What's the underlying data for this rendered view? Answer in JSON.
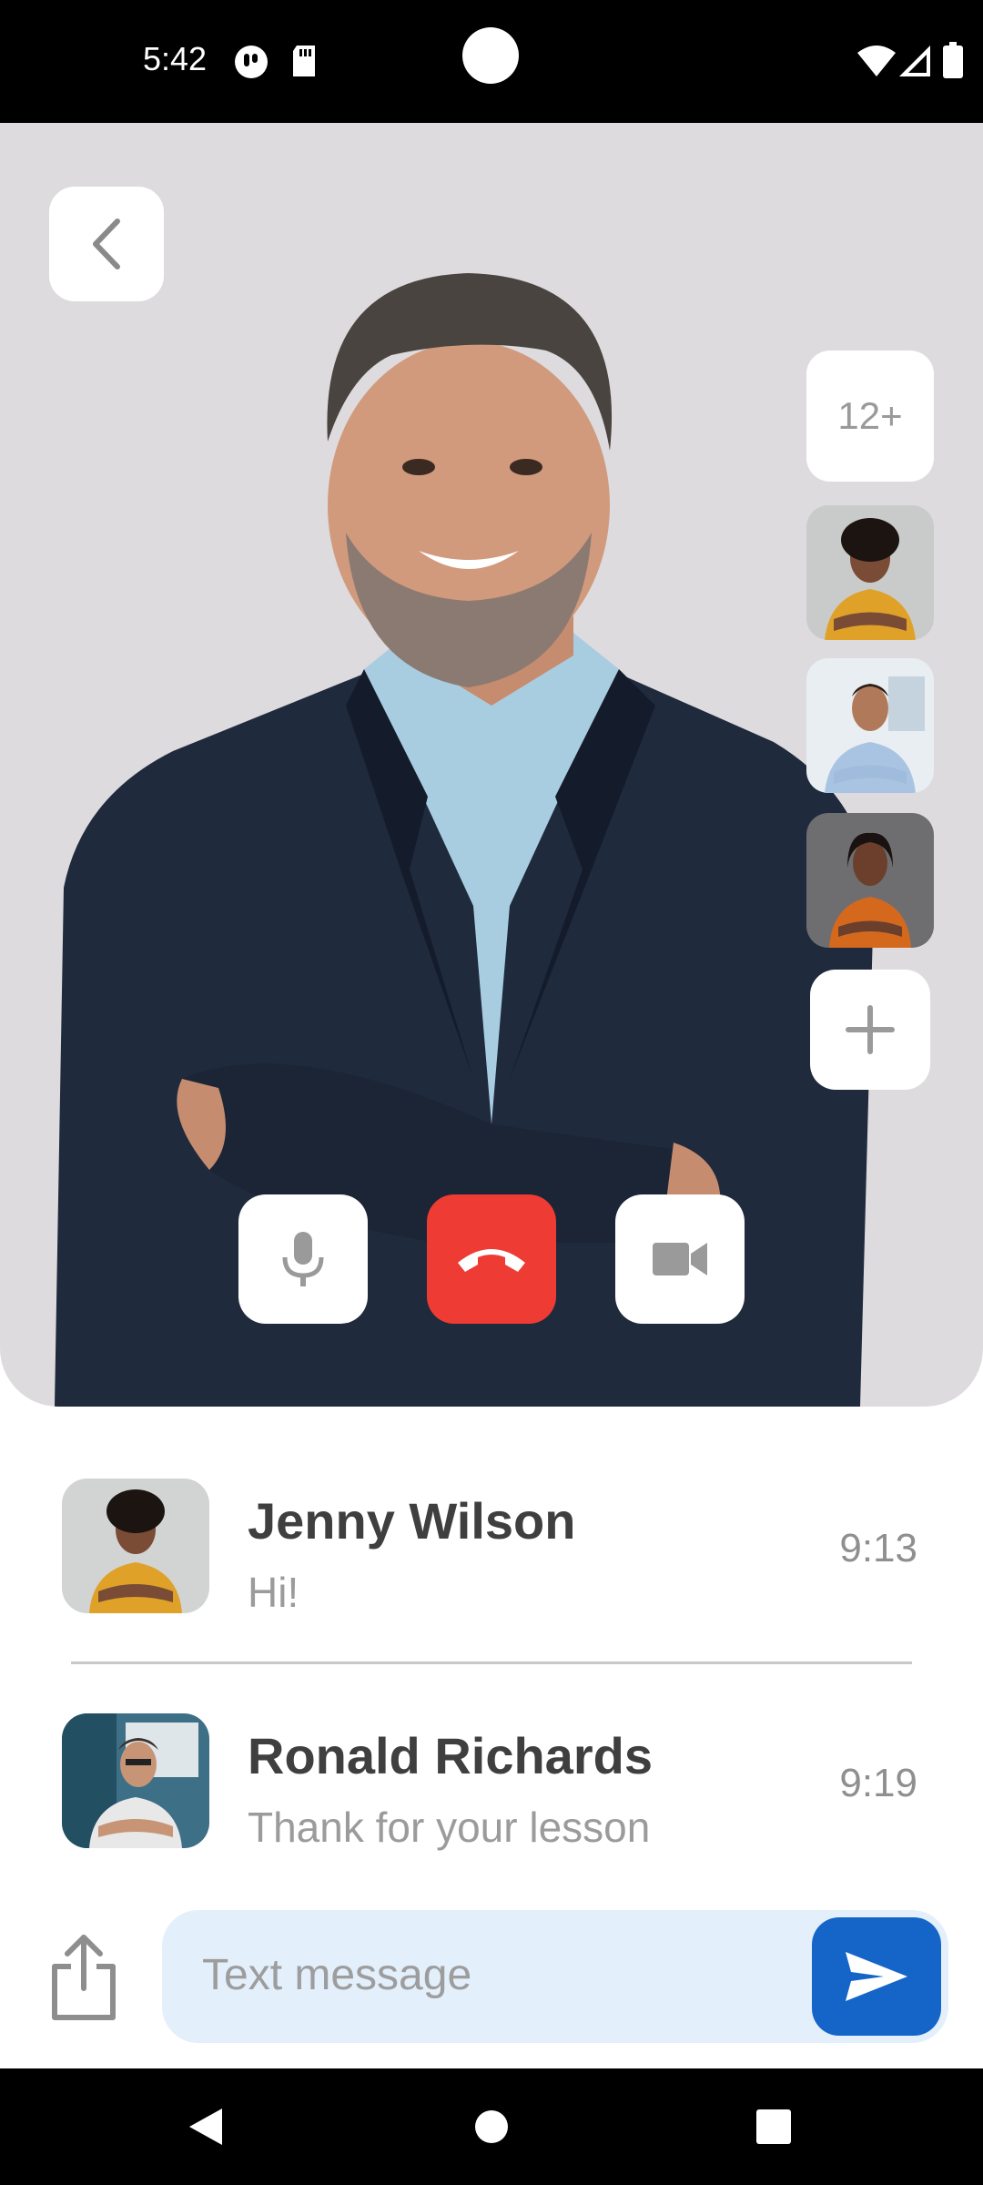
{
  "status_bar": {
    "time": "5:42",
    "left_icons": [
      "app-notification-icon",
      "sd-card-icon"
    ],
    "right_icons": [
      "wifi-icon",
      "signal-icon",
      "battery-icon"
    ]
  },
  "video_call": {
    "participants_more_label": "12+",
    "participant_thumbnails": [
      "participant-woman-yellow-shirt",
      "participant-man-blue-shirt",
      "participant-woman-orange-shirt"
    ],
    "controls": {
      "mic": "microphone-icon",
      "end_call": "phone-hangup-icon",
      "camera": "video-camera-icon"
    },
    "colors": {
      "background": "#dddbde",
      "end_call": "#ee3b33"
    }
  },
  "chats": [
    {
      "name": "Jenny Wilson",
      "message": "Hi!",
      "time": "9:13"
    },
    {
      "name": "Ronald Richards",
      "message": "Thank for your lesson",
      "time": "9:19"
    }
  ],
  "composer": {
    "placeholder": "Text message",
    "send_color": "#1565c8"
  },
  "nav_bar": {
    "buttons": [
      "back-triangle-icon",
      "home-circle-icon",
      "recents-square-icon"
    ]
  }
}
